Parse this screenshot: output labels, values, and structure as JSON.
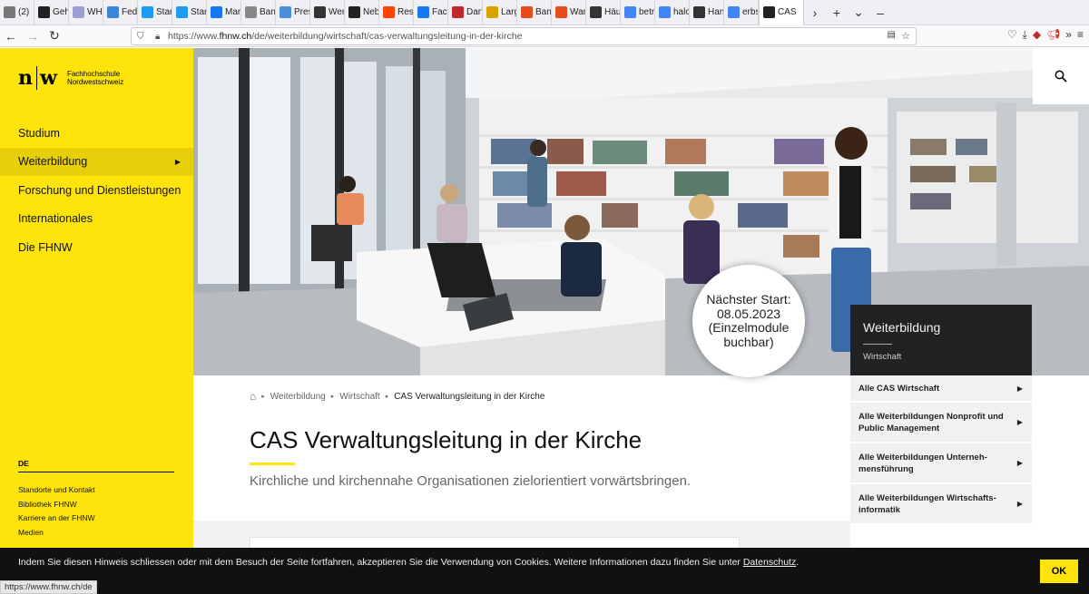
{
  "browser": {
    "tabs": [
      {
        "label": "(2)",
        "icon": "notification-icon",
        "color": "#777777"
      },
      {
        "label": "Geh",
        "icon": "news-icon",
        "color": "#222222"
      },
      {
        "label": "WHA",
        "icon": "star-icon",
        "color": "#9aa0d0"
      },
      {
        "label": "Fede",
        "icon": "fediverse-icon",
        "color": "#3a86d8"
      },
      {
        "label": "Start",
        "icon": "bird-icon",
        "color": "#1d9bf0"
      },
      {
        "label": "Start",
        "icon": "bird-icon",
        "color": "#1d9bf0"
      },
      {
        "label": "Marc",
        "icon": "f-icon",
        "color": "#1877f2"
      },
      {
        "label": "Bana",
        "icon": "at-icon",
        "color": "#888888"
      },
      {
        "label": "Press",
        "icon": "drop-icon",
        "color": "#4a90d9"
      },
      {
        "label": "Wen",
        "icon": "news-icon",
        "color": "#333333"
      },
      {
        "label": "Neb",
        "icon": "a-icon",
        "color": "#222222"
      },
      {
        "label": "Rese",
        "icon": "reddit-icon",
        "color": "#ff4500"
      },
      {
        "label": "Face",
        "icon": "f-icon",
        "color": "#1877f2"
      },
      {
        "label": "Darf",
        "icon": "be-icon",
        "color": "#c0282d"
      },
      {
        "label": "Larg",
        "icon": "bookmark-icon",
        "color": "#d6a400"
      },
      {
        "label": "Bana",
        "icon": "shield-icon",
        "color": "#e54e1b"
      },
      {
        "label": "Ware",
        "icon": "shield-icon",
        "color": "#e54e1b"
      },
      {
        "label": "Häuf",
        "icon": "triangle-icon",
        "color": "#333333"
      },
      {
        "label": "betr",
        "icon": "g-icon",
        "color": "#4285f4"
      },
      {
        "label": "halo",
        "icon": "g-icon",
        "color": "#4285f4"
      },
      {
        "label": "Han",
        "icon": "w-icon",
        "color": "#333333"
      },
      {
        "label": "erbs",
        "icon": "g-icon",
        "color": "#4285f4"
      },
      {
        "label": "CAS",
        "icon": "nw-icon",
        "color": "#222222"
      }
    ],
    "url_prefix": "https://www.",
    "url_host": "fhnw.ch",
    "url_path": "/de/weiterbildung/wirtschaft/cas-verwaltungsleitung-in-der-kirche",
    "status_url": "https://www.fhnw.ch/de"
  },
  "site": {
    "logo_mark_left": "n",
    "logo_mark_right": "w",
    "logo_line1": "Fachhochschule",
    "logo_line2": "Nordwestschweiz",
    "nav": [
      {
        "label": "Studium"
      },
      {
        "label": "Weiterbildung"
      },
      {
        "label": "Forschung und Dienstleistungen"
      },
      {
        "label": "Internationales"
      },
      {
        "label": "Die FHNW"
      }
    ],
    "lang": "DE",
    "footer_links": [
      "Standorte und Kontakt",
      "Bibliothek FHNW",
      "Karriere an der FHNW",
      "Medien"
    ],
    "accent_color": "#ffe40c"
  },
  "hero": {
    "badge_lines": [
      "Nächster Start:",
      "08.05.2023",
      "(Einzelmodule",
      "buchbar)"
    ]
  },
  "panel": {
    "title": "Weiterbildung",
    "subtitle": "Wirtschaft",
    "links": [
      {
        "label": "Alle CAS Wirtschaft"
      },
      {
        "label": "Alle Weiterbildungen Nonprofit und Public Management"
      },
      {
        "label": "Alle Weiterbildungen Unterneh-mensführung"
      },
      {
        "label": "Alle Weiterbildungen Wirtschafts-informatik"
      }
    ]
  },
  "breadcrumb": {
    "items": [
      "Weiterbildung",
      "Wirtschaft"
    ],
    "current": "CAS Verwaltungsleitung in der Kirche"
  },
  "page": {
    "title": "CAS Verwaltungsleitung in der Kirche",
    "subtitle": "Kirchliche und kirchennahe Organisationen zielorientiert vorwärtsbringen."
  },
  "cookie": {
    "text": "Indem Sie diesen Hinweis schliessen oder mit dem Besuch der Seite fortfahren, akzeptieren Sie die Verwendung von Cookies. Weitere Informationen dazu finden Sie unter ",
    "link": "Datenschutz",
    "after": ".",
    "ok": "OK"
  }
}
